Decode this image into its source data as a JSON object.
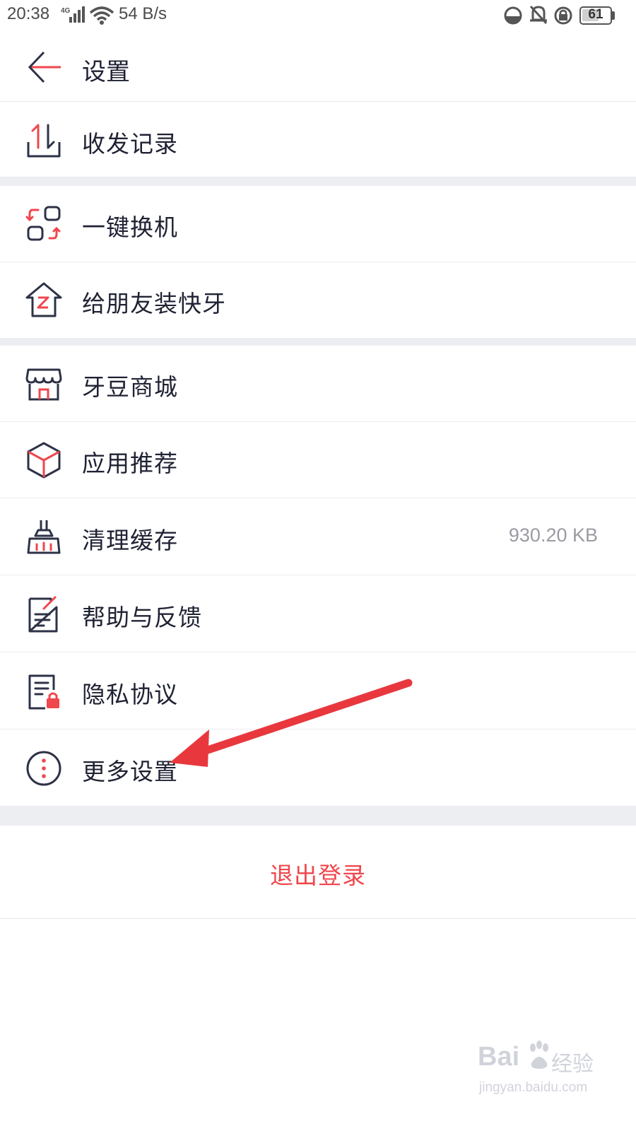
{
  "status_bar": {
    "time": "20:38",
    "network": "4G",
    "speed": "54 B/s",
    "battery": 61
  },
  "header": {
    "title": "设置",
    "back_icon": "back-arrow-icon"
  },
  "menu": [
    {
      "label": "收发记录",
      "icon": "transfer-record-icon",
      "value": ""
    },
    {
      "label": "一键换机",
      "icon": "phone-switch-icon",
      "value": ""
    },
    {
      "label": "给朋友装快牙",
      "icon": "install-for-friend-icon",
      "value": ""
    },
    {
      "label": "牙豆商城",
      "icon": "store-icon",
      "value": "",
      "blurred_value": true
    },
    {
      "label": "应用推荐",
      "icon": "app-cube-icon",
      "value": ""
    },
    {
      "label": "清理缓存",
      "icon": "broom-icon",
      "value": "930.20 KB"
    },
    {
      "label": "帮助与反馈",
      "icon": "feedback-icon",
      "value": ""
    },
    {
      "label": "隐私协议",
      "icon": "privacy-doc-icon",
      "value": ""
    },
    {
      "label": "更多设置",
      "icon": "more-dots-icon",
      "value": ""
    }
  ],
  "logout": {
    "label": "退出登录"
  },
  "watermark": {
    "brand": "Bai",
    "suffix": "经验",
    "url": "jingyan.baidu.com"
  },
  "colors": {
    "accent": "#f0464d",
    "icon_dark": "#2e3247",
    "text": "#1f2233",
    "secondary": "#9a9ba3",
    "divider_gap": "#eceef2"
  }
}
